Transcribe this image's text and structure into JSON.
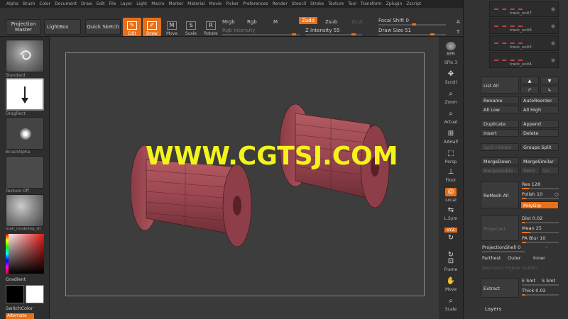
{
  "menu": [
    "Alpha",
    "Brush",
    "Color",
    "Document",
    "Draw",
    "Edit",
    "File",
    "Layer",
    "Light",
    "Macro",
    "Marker",
    "Material",
    "Movie",
    "Picker",
    "Preferences",
    "Render",
    "Stencil",
    "Stroke",
    "Texture",
    "Tool",
    "Transform",
    "Zplugin",
    "Zscript"
  ],
  "toolbar": {
    "projection_master": "Projection Master",
    "lightbox": "LightBox",
    "quick_sketch": "Quick Sketch",
    "edit": "Edit",
    "draw": "Draw",
    "move": "Move",
    "scale": "Scale",
    "rotate": "Rotate",
    "mrgb": "Mrgb",
    "rgb": "Rgb",
    "m": "M",
    "zadd": "Zadd",
    "zsub": "Zsub",
    "zcut": "Zcut",
    "rgb_intensity": "Rgb Intensity",
    "z_intensity": "Z Intensity 55",
    "focal_shift": "Focal Shift 0",
    "draw_size": "Draw Size 51",
    "a_label": "A",
    "t_label": "T"
  },
  "leftshelf": {
    "standard": "Standard",
    "dragrect": "DragRect",
    "brushalpha": "BrushAlpha",
    "texture_off": "Texture Off",
    "material": "mah_modeling_UI",
    "gradient": "Gradient",
    "switchcolor": "SwitchColor",
    "alternate": "Alternate"
  },
  "watermark": "WWW.CGTSJ.COM",
  "iconstrip": {
    "bpr": "BPR",
    "spix": "SPix 3",
    "scroll": "Scroll",
    "zoom": "Zoom",
    "actual": "Actual",
    "aahalf": "AAHalf",
    "persp": "Persp",
    "floor": "Floor",
    "local": "Local",
    "lsym": "L.Sym",
    "xyz": "xYZ",
    "frame": "Frame",
    "move": "Move",
    "scale": "Scale"
  },
  "rightpanel": {
    "subtools": [
      "track_unit7",
      "track_unit6",
      "track_unit5",
      "track_unit4"
    ],
    "list_all": "List All",
    "rename": "Rename",
    "autoreorder": "AutoReorder",
    "all_low": "All Low",
    "all_high": "All High",
    "duplicate": "Duplicate",
    "append": "Append",
    "insert": "Insert",
    "delete": "Delete",
    "split_hidden": "Split Hidden",
    "groups_split": "Groups Split",
    "mergedown": "MergeDown",
    "mergesimilar": "MergeSimilar",
    "mergevisible": "MergeVisible",
    "weld": "Weld",
    "uv": "Uv",
    "remesh_all": "ReMesh All",
    "res": "Res 128",
    "polish": "Polish 10",
    "polygrp": "PolyGrp",
    "projectall": "ProjectAll",
    "dist": "Dist 0.02",
    "mean": "Mean 25",
    "pa_blur": "PA Blur 10",
    "projectionshell": "ProjectionShell 0",
    "farthest": "Farthest",
    "outer": "Outer",
    "inner": "Inner",
    "reproject": "Reproject Higher Subdiv",
    "extract": "Extract",
    "e_smt": "E Smt",
    "s_smt": "S Smt",
    "thick": "Thick 0.02",
    "layers": "Layers"
  },
  "colors": {
    "accent": "#e8701a",
    "watermark": "#f4f41a",
    "spool": "#a04850"
  }
}
